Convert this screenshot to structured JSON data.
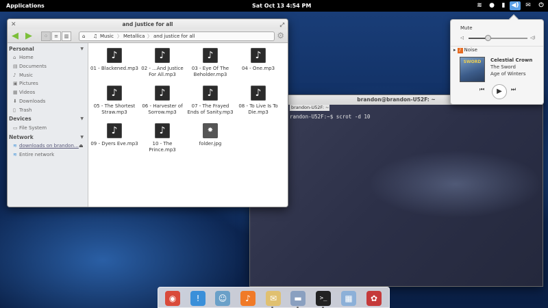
{
  "panel": {
    "apps_label": "Applications",
    "clock": "Sat Oct 13  4:54 PM",
    "indicators": [
      {
        "name": "wifi-icon",
        "glyph": "≋"
      },
      {
        "name": "user-icon",
        "glyph": "●"
      },
      {
        "name": "battery-icon",
        "glyph": "▮"
      },
      {
        "name": "sound-icon",
        "glyph": "◀)"
      },
      {
        "name": "mail-icon",
        "glyph": "✉"
      },
      {
        "name": "power-icon",
        "glyph": "⏻"
      }
    ]
  },
  "file_manager": {
    "title": "and justice for all",
    "breadcrumbs": [
      "Music",
      "Metallica",
      "and justice for all"
    ],
    "sidebar": {
      "personal_label": "Personal",
      "personal": [
        {
          "label": "Home",
          "icon": "home-icon",
          "glyph": "⌂"
        },
        {
          "label": "Documents",
          "icon": "documents-icon",
          "glyph": "▤"
        },
        {
          "label": "Music",
          "icon": "music-icon",
          "glyph": "♪"
        },
        {
          "label": "Pictures",
          "icon": "pictures-icon",
          "glyph": "▣"
        },
        {
          "label": "Videos",
          "icon": "videos-icon",
          "glyph": "▦"
        },
        {
          "label": "Downloads",
          "icon": "downloads-icon",
          "glyph": "⬇"
        },
        {
          "label": "Trash",
          "icon": "trash-icon",
          "glyph": "🗑"
        }
      ],
      "devices_label": "Devices",
      "devices": [
        {
          "label": "File System",
          "icon": "drive-icon",
          "glyph": "▭"
        }
      ],
      "network_label": "Network",
      "network": [
        {
          "label": "downloads on brandon…",
          "icon": "network-icon",
          "glyph": "≋"
        },
        {
          "label": "Entire network",
          "icon": "network-icon",
          "glyph": "≋"
        }
      ]
    },
    "files": [
      {
        "name": "01 - Blackened.mp3",
        "type": "audio"
      },
      {
        "name": "02 - ...And Justice For All.mp3",
        "type": "audio"
      },
      {
        "name": "03 - Eye Of The Beholder.mp3",
        "type": "audio"
      },
      {
        "name": "04 - One.mp3",
        "type": "audio"
      },
      {
        "name": "05 - The Shortest Straw.mp3",
        "type": "audio"
      },
      {
        "name": "06 - Harvester of Sorrow.mp3",
        "type": "audio"
      },
      {
        "name": "07 - The Frayed Ends of Sanity.mp3",
        "type": "audio"
      },
      {
        "name": "08 - To Live Is To Die.mp3",
        "type": "audio"
      },
      {
        "name": "09 - Dyers Eve.mp3",
        "type": "audio"
      },
      {
        "name": "10 - The Prince.mp3",
        "type": "audio"
      },
      {
        "name": "folder.jpg",
        "type": "image"
      }
    ]
  },
  "terminal": {
    "title": "brandon@brandon-U52F: ~",
    "tab_label": "brandon-U52F: ~",
    "line": "randon-U52F:~$ scrot -d 10"
  },
  "sound_menu": {
    "mute_label": "Mute",
    "volume_fraction": 0.32,
    "player_name": "Noise",
    "album_text": "SWORD",
    "track_title": "Celestial Crown",
    "artist": "The Sword",
    "album": "Age of Winters"
  },
  "dock": [
    {
      "name": "chrome-icon",
      "glyph": "◉",
      "color": "#d94a3a"
    },
    {
      "name": "messaging-icon",
      "glyph": "!",
      "color": "#3a8fd9"
    },
    {
      "name": "contacts-icon",
      "glyph": "☺",
      "color": "#6aa0c8"
    },
    {
      "name": "music-player-icon",
      "glyph": "♪",
      "color": "#f07a28"
    },
    {
      "name": "mail-app-icon",
      "glyph": "✉",
      "color": "#e0c070"
    },
    {
      "name": "files-icon",
      "glyph": "▬",
      "color": "#8aa0c0"
    },
    {
      "name": "terminal-icon",
      "glyph": ">_",
      "color": "#222"
    },
    {
      "name": "workspaces-icon",
      "glyph": "▦",
      "color": "#8cb0d8"
    },
    {
      "name": "bug-tracker-icon",
      "glyph": "✿",
      "color": "#c53a3a"
    }
  ]
}
